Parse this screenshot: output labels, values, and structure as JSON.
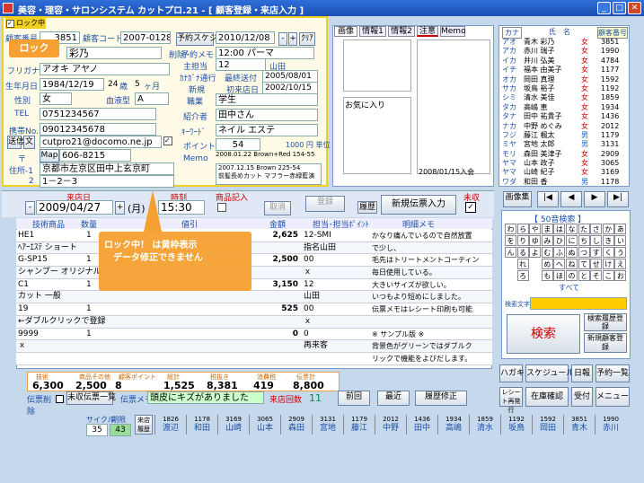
{
  "window": {
    "title": "美容・理容・サロンシステム カットプロ.21 - [ 顧客登録・来店入力 ]",
    "min": "_",
    "max": "□",
    "close": "✕"
  },
  "lock": {
    "checkbox_label": "ロック中",
    "tooltip1": "ロック",
    "tooltip2_line1": "ロック中！ は黄枠表示",
    "tooltip2_line2": "データ修正できません"
  },
  "customer": {
    "no_label": "顧客番号",
    "no": "3851",
    "code_label": "顧客コード",
    "code": "2007-0128",
    "sched_label": "予約スケジュール",
    "sched_date": "2010/12/08",
    "sched_btn_minus": "-",
    "sched_btn_plus": "+",
    "clear_btn": "ｸﾘｱ",
    "name_label": "氏名",
    "name": "彩乃",
    "delete_label": "削除",
    "furigana_label": "フリガナ",
    "furigana": "アオキ アヤノ",
    "birth_label": "生年月日",
    "birth": "1984/12/19",
    "age": "24",
    "age_unit": "歳",
    "months": "5",
    "months_unit": "ヶ月",
    "gender_label": "性別",
    "gender": "女",
    "blood_label": "血液型",
    "blood": "A",
    "tel_label": "TEL",
    "tel": "0751234567",
    "mobile_label": "携帯No.",
    "mobile": "09012345678",
    "mail_btn1": "送信",
    "mail_btn2": "文",
    "email": "cutpro21@docomo.ne.jp",
    "zip_label": "〒",
    "map_btn": "Map",
    "zip": "606-8215",
    "addr_label": "住所-1",
    "addr1": "京都市左京区田中上玄京町",
    "addr2_label": "2",
    "addr2": "1－2－3",
    "yoyaku_label": "予約メモ",
    "yoyaku": "12:00 パーマ",
    "stylist_label": "主担当",
    "stylist_no": "12",
    "stylist": "山田",
    "kanayomi_label": "ｶﾅｶﾞﾅ通行",
    "last_visit_label": "最終送付",
    "last_visit": "2005/08/01",
    "new_label": "新規",
    "first_visit_label": "初来店日",
    "first_visit": "2002/10/15",
    "job_label": "職業",
    "job": "学生",
    "intro_label": "紹介者",
    "intro": "田中さん",
    "keyword_label": "ｷｰﾜｰﾄﾞ",
    "keyword": "ネイル エステ",
    "point_label": "ポイント",
    "point": "54",
    "point_unit": "1000 円 単位",
    "memo_label": "Memo",
    "memo1": "2008.01.22 Brown+Red 154-55",
    "memo2": "2007.12.15 Brown 225-54",
    "memo3": "前髪長めカット マフラー赤緑藍演"
  },
  "tabs": {
    "t1": "画像",
    "t2": "情報1",
    "t3": "情報2",
    "t4": "注意",
    "t5": "Memo"
  },
  "note": {
    "fav": "お気に入り",
    "date": "2008/01/15入会"
  },
  "clist": {
    "h_kana": "カナ",
    "h_name": "氏　名",
    "h_no": "顧客番号",
    "rows": [
      {
        "k": "アオ",
        "n": "青木 彩乃",
        "g": "女",
        "no": "3851"
      },
      {
        "k": "アカ",
        "n": "赤川 瑞子",
        "g": "女",
        "no": "1990"
      },
      {
        "k": "イカ",
        "n": "井川 弘美",
        "g": "女",
        "no": "4784"
      },
      {
        "k": "イチ",
        "n": "福本 由美子",
        "g": "女",
        "no": "1177"
      },
      {
        "k": "オカ",
        "n": "岡田 真理",
        "g": "女",
        "no": "1592"
      },
      {
        "k": "サカ",
        "n": "坂鳥 裕子",
        "g": "女",
        "no": "1192"
      },
      {
        "k": "シミ",
        "n": "清水 美佳",
        "g": "女",
        "no": "1859"
      },
      {
        "k": "タカ",
        "n": "高嶋 恵",
        "g": "女",
        "no": "1934"
      },
      {
        "k": "タナ",
        "n": "田中 祐貴子",
        "g": "女",
        "no": "1436"
      },
      {
        "k": "ナカ",
        "n": "中野 めぐみ",
        "g": "女",
        "no": "2012"
      },
      {
        "k": "フジ",
        "n": "藤江 楓太",
        "g": "男",
        "no": "1179"
      },
      {
        "k": "ミヤ",
        "n": "宮地 太郎",
        "g": "男",
        "no": "3131"
      },
      {
        "k": "モリ",
        "n": "森田 美津子",
        "g": "女",
        "no": "2909"
      },
      {
        "k": "ヤマ",
        "n": "山本 政子",
        "g": "女",
        "no": "3065"
      },
      {
        "k": "ヤマ",
        "n": "山崎 紀子",
        "g": "女",
        "no": "3169"
      },
      {
        "k": "ワダ",
        "n": "和田 香",
        "g": "男",
        "no": "1178"
      }
    ]
  },
  "visit": {
    "date_label": "来店日",
    "date": "2009/04/27",
    "weekday": "(月)",
    "time_label": "時刻",
    "time": "15:30",
    "goods_label": "商品記入",
    "cancel": "取消",
    "register": "登録",
    "history_btn": "履歴",
    "new_slip": "新規伝票入力",
    "unsettled": "未収"
  },
  "items": {
    "h1": "技術商品",
    "h2": "数量",
    "h3": "値引",
    "h4": "金額",
    "h5": "担当･担当ﾎﾟｲﾝﾄ",
    "h6": "明細メモ",
    "rows": [
      {
        "code": "HE1",
        "qty": "1",
        "amt": "2,625",
        "staff": "12-SMI",
        "memo": "かなり痛んでいるので自然放置"
      },
      {
        "code": "ﾍｱｰｴｽﾃ ショート",
        "qty": "",
        "amt": "",
        "staff": "指名山田",
        "memo": "で少し、"
      },
      {
        "code": "G-SP15",
        "qty": "1",
        "amt": "2,500",
        "staff": "00",
        "memo": "毛先はトリートメントコーティン"
      },
      {
        "code": "シャンプー オリジナル",
        "qty": "",
        "amt": "",
        "staff": "ｘ",
        "memo": "毎日使用している。"
      },
      {
        "code": "C1",
        "qty": "1",
        "amt": "3,150",
        "staff": "12",
        "memo": "大きいサイズが欲しい。"
      },
      {
        "code": "カット 一般",
        "qty": "",
        "amt": "",
        "staff": "山田",
        "memo": "いつもより短めにしました。"
      },
      {
        "code": "19",
        "qty": "1",
        "amt": "525",
        "staff": "00",
        "memo": "伝票メモはレシート印刷も可能"
      },
      {
        "code": "←ダブルクリックで登録",
        "qty": "",
        "amt": "",
        "staff": "ｘ",
        "memo": ""
      },
      {
        "code": "9999",
        "qty": "1",
        "amt": "0",
        "staff": "0",
        "memo": "※ サンプル版 ※"
      },
      {
        "code": "ｘ",
        "qty": "",
        "amt": "",
        "staff": "再来客",
        "memo": "背景色がグリーンではダブルク"
      },
      {
        "code": "",
        "qty": "",
        "amt": "",
        "staff": "",
        "memo": "リックで機能をよびだします。"
      }
    ]
  },
  "totals": {
    "tech_l": "技術",
    "tech": "6,300",
    "goods_l": "商品その他",
    "goods": "2,500",
    "pt_l": "顧客ポイント",
    "pt": "8",
    "tot_l": "総計",
    "tot": "1,525",
    "tax_l": "税抜き",
    "taxex": "8,381",
    "ctax_l": "消費税",
    "ctax": "419",
    "slip_l": "伝票計",
    "slip": "8,800"
  },
  "footer": {
    "del_label": "伝票削除",
    "unpaid_btn": "未収伝票一覧",
    "memo_label": "伝票メモ",
    "memo": "頭皮にキズがありました",
    "count_label": "来店回数",
    "count": "11",
    "prev": "前回",
    "latest": "最近",
    "history": "履歴修正"
  },
  "cycle": {
    "label1": "サイクル",
    "label2": "期限",
    "v1": "35",
    "v2": "43",
    "hist_label": "来店履歴"
  },
  "hist": [
    {
      "no": "1826",
      "n": "渡辺"
    },
    {
      "no": "1178",
      "n": "和田"
    },
    {
      "no": "3169",
      "n": "山崎"
    },
    {
      "no": "3065",
      "n": "山本"
    },
    {
      "no": "2909",
      "n": "森田"
    },
    {
      "no": "3131",
      "n": "宮地"
    },
    {
      "no": "1179",
      "n": "藤江"
    },
    {
      "no": "2012",
      "n": "中野"
    },
    {
      "no": "1436",
      "n": "田中"
    },
    {
      "no": "1934",
      "n": "高嶋"
    },
    {
      "no": "1859",
      "n": "清水"
    },
    {
      "no": "1192",
      "n": "坂鳥"
    },
    {
      "no": "1592",
      "n": "岡田"
    },
    {
      "no": "3851",
      "n": "青木"
    },
    {
      "no": "1990",
      "n": "赤川"
    }
  ],
  "nav": {
    "image": "画像集",
    "first": "|◀",
    "prev": "◀",
    "next": "▶",
    "last": "▶|"
  },
  "kana": {
    "title": "【 50音検索 】",
    "chars": [
      "わ",
      "ら",
      "や",
      "ま",
      "は",
      "な",
      "た",
      "さ",
      "か",
      "あ",
      "を",
      "り",
      "ゆ",
      "み",
      "ひ",
      "に",
      "ち",
      "し",
      "き",
      "い",
      "ん",
      "る",
      "よ",
      "む",
      "ふ",
      "ぬ",
      "つ",
      "す",
      "く",
      "う",
      "",
      "れ",
      "",
      "め",
      "へ",
      "ね",
      "て",
      "せ",
      "け",
      "え",
      "",
      "ろ",
      "",
      "も",
      "ほ",
      "の",
      "と",
      "そ",
      "こ",
      "お"
    ],
    "all": "すべて"
  },
  "search": {
    "text_label": "検索文字",
    "btn": "検索",
    "hist_btn": "検索履歴登録",
    "new_btn": "新規顧客登録"
  },
  "rbtns": {
    "postcard": "ハガキ",
    "schedule": "スケジュール",
    "daily": "日報",
    "reserve": "予約一覧",
    "receipt": "レシート再発行",
    "stock": "在庫確認",
    "reception": "受付",
    "menu": "メニュー"
  }
}
